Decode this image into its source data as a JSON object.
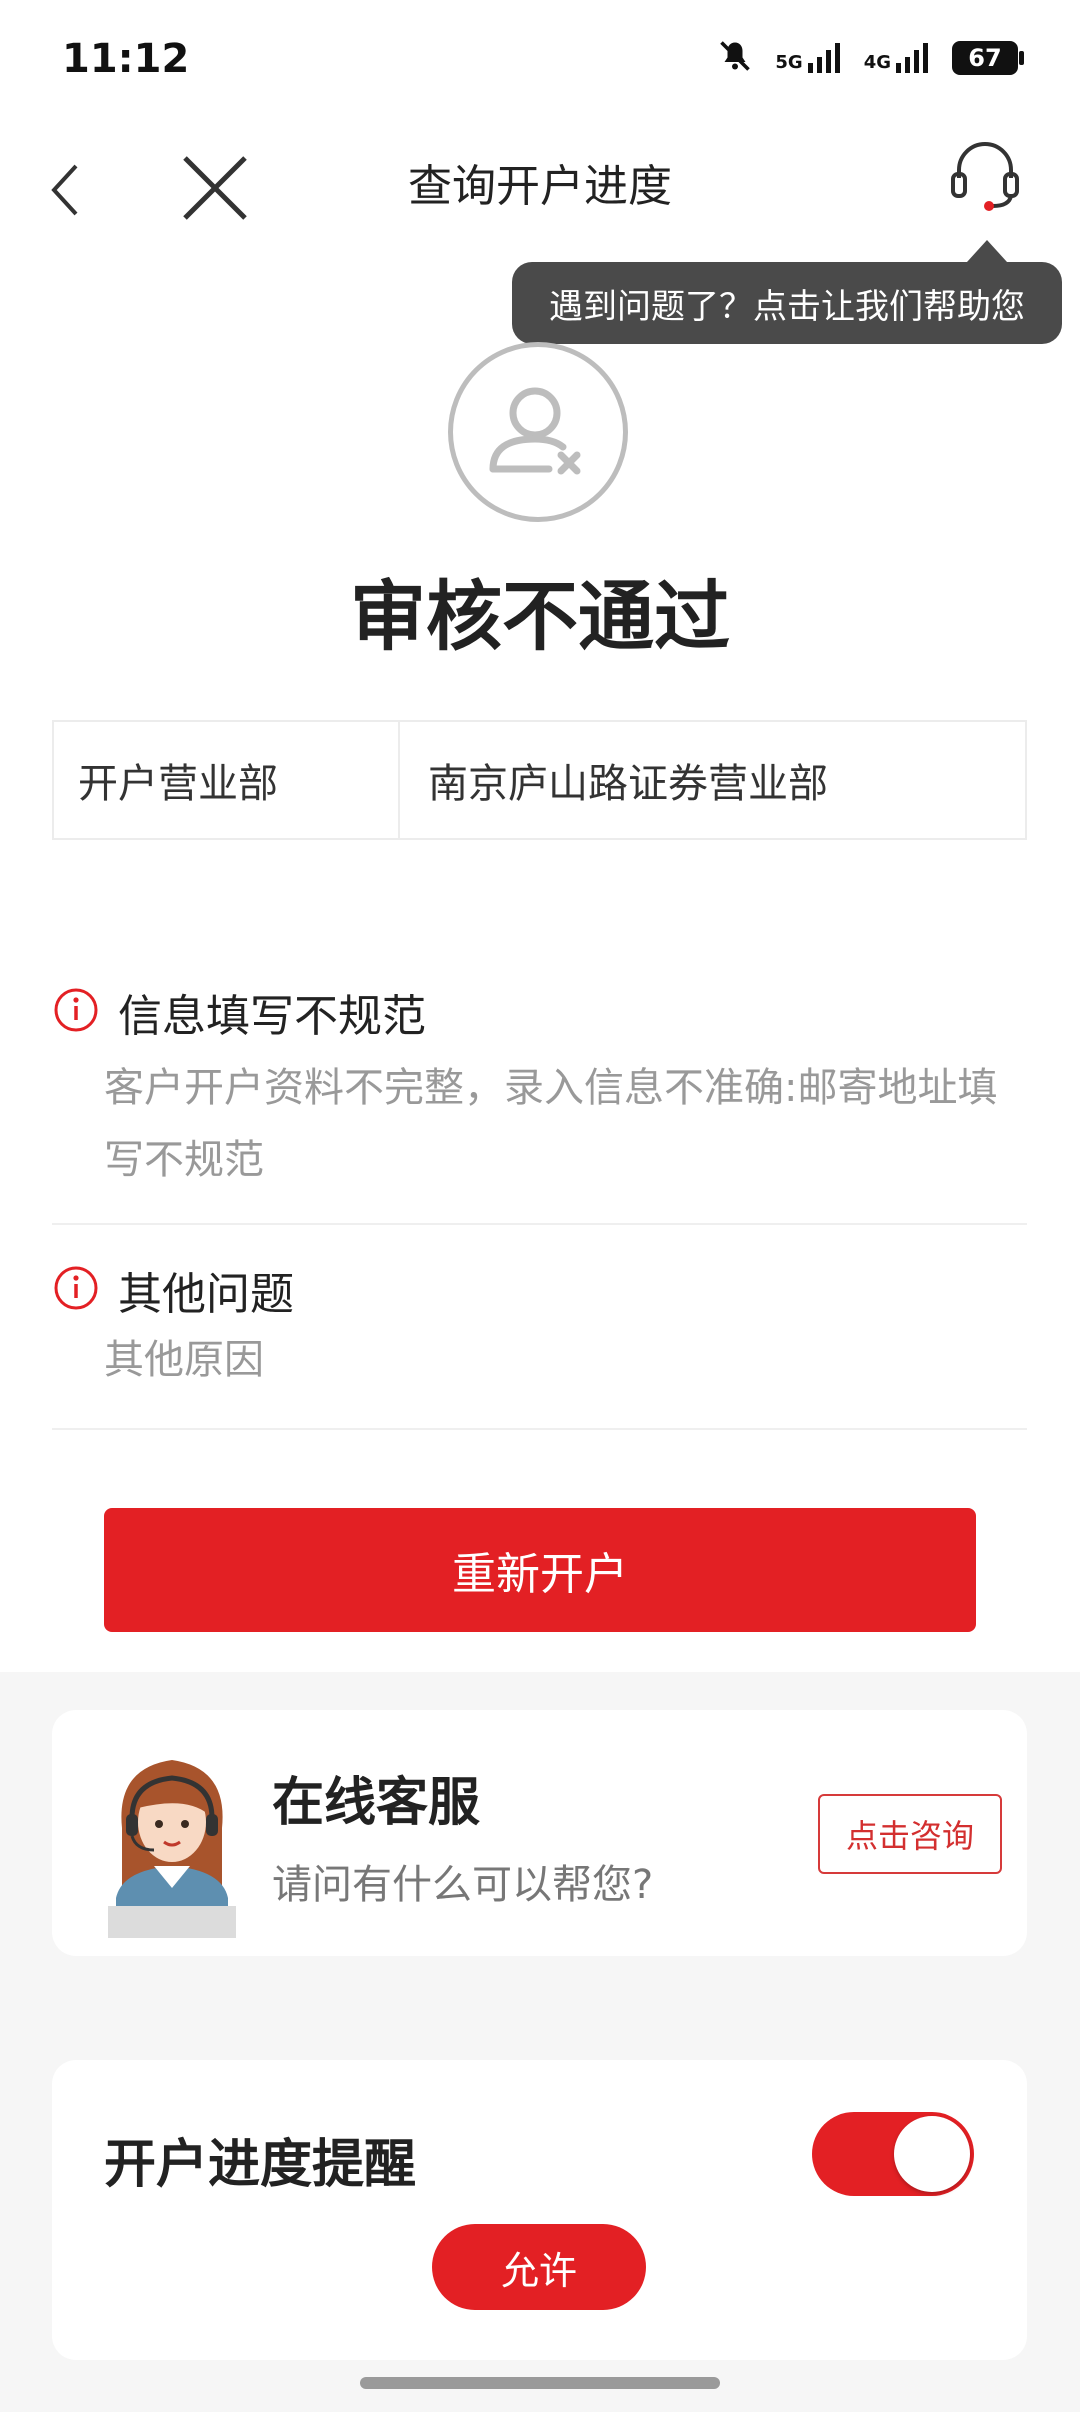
{
  "status_bar": {
    "time": "11:12",
    "network_1": "5G",
    "network_2": "4G",
    "battery": "67",
    "icons": [
      "mute-bell-icon",
      "signal-5g-icon",
      "signal-4g-icon",
      "battery-icon"
    ]
  },
  "nav": {
    "title": "查询开户进度",
    "back_icon": "chevron-left-icon",
    "close_icon": "close-icon",
    "support_icon": "headset-icon"
  },
  "tooltip": {
    "text": "遇到问题了？点击让我们帮助您"
  },
  "result": {
    "icon": "user-rejected-icon",
    "title": "审核不通过"
  },
  "info_table": {
    "label": "开户营业部",
    "value": "南京庐山路证券营业部"
  },
  "issues": [
    {
      "title": "信息填写不规范",
      "desc": "客户开户资料不完整，录入信息不准确:邮寄地址填写不规范",
      "icon": "info-circle-icon"
    },
    {
      "title": "其他问题",
      "desc": "其他原因",
      "icon": "info-circle-icon"
    }
  ],
  "actions": {
    "reopen_label": "重新开户"
  },
  "service_card": {
    "title": "在线客服",
    "subtitle": "请问有什么可以帮您?",
    "consult_label": "点击咨询",
    "agent_icon": "customer-service-agent-avatar"
  },
  "reminder": {
    "title": "开户进度提醒",
    "toggle_on": true,
    "allow_label": "允许"
  },
  "colors": {
    "primary_red": "#e32024",
    "tooltip_bg": "#4a4a4a",
    "muted_text": "#999999"
  }
}
